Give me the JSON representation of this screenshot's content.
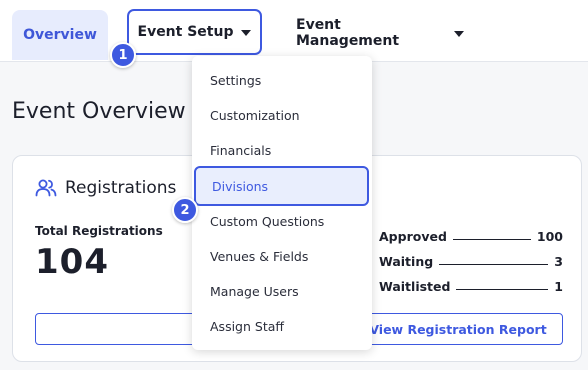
{
  "nav": {
    "overview_label": "Overview",
    "event_setup_label": "Event Setup",
    "event_management_label": "Event Management"
  },
  "steps": {
    "one": "1",
    "two": "2"
  },
  "page": {
    "title": "Event Overview"
  },
  "registrations": {
    "title": "Registrations",
    "total_label": "Total Registrations",
    "total_value": "104",
    "stats": [
      {
        "label": "Approved",
        "value": "100"
      },
      {
        "label": "Waiting",
        "value": "3"
      },
      {
        "label": "Waitlisted",
        "value": "1"
      }
    ],
    "report_button_label": "View Registration Report"
  },
  "dropdown": {
    "items": [
      {
        "label": "Settings"
      },
      {
        "label": "Customization"
      },
      {
        "label": "Financials"
      },
      {
        "label": "Divisions",
        "selected": true
      },
      {
        "label": "Custom Questions"
      },
      {
        "label": "Venues & Fields"
      },
      {
        "label": "Manage Users"
      },
      {
        "label": "Assign Staff"
      }
    ]
  },
  "colors": {
    "accent": "#3e59e0",
    "tab_bg": "#e7ecfd",
    "page_bg": "#f6f7f9"
  },
  "icons": {
    "registrations": "users-icon",
    "setup_caret": "caret-down-icon",
    "management_caret": "caret-down-icon"
  }
}
